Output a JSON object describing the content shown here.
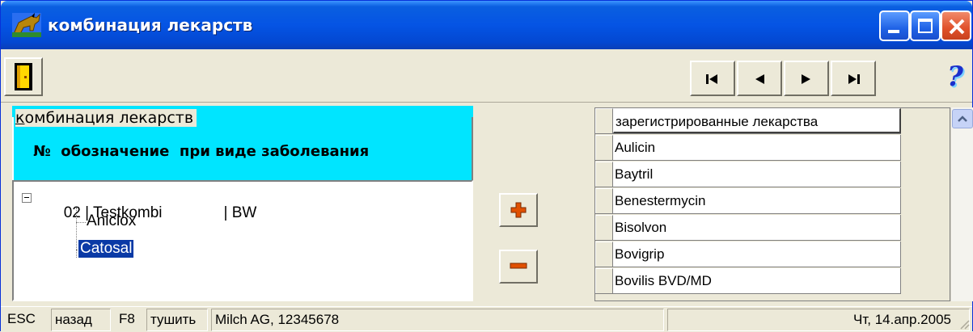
{
  "window": {
    "title": "комбинация лекарств",
    "title_icon": "horse-app-icon"
  },
  "toolbar": {
    "exit_icon": "door-exit-icon",
    "nav": [
      "first-record-icon",
      "previous-record-icon",
      "next-record-icon",
      "last-record-icon"
    ],
    "help_label": "?"
  },
  "left_panel": {
    "group_label_first": "к",
    "group_label_rest": "омбинация лекарств",
    "header": {
      "no": "№",
      "designation": "обозначение",
      "disease": "при виде заболевания"
    },
    "tree": {
      "root_no": "02",
      "root_name": "Testkombi",
      "root_species": "BW",
      "children": [
        "Aniclox",
        "Catosal"
      ],
      "selected": "Catosal"
    }
  },
  "buttons": {
    "add_icon": "plus-icon",
    "remove_icon": "minus-icon"
  },
  "grid": {
    "header": "зарегистрированные лекарства",
    "rows": [
      "Aulicin",
      "Baytril",
      "Benestermycin",
      "Bisolvon",
      "Bovigrip",
      "Bovilis BVD/MD"
    ]
  },
  "statusbar": {
    "esc_key": "ESC",
    "esc_label": "назад",
    "f8_key": "F8",
    "f8_label": "тушить",
    "company": "Milch AG, 12345678",
    "date": "Чт, 14.апр.2005"
  },
  "colors": {
    "title_bar": "#0554e4",
    "panel_cyan": "#00e5ff",
    "selection": "#0a3aa6"
  }
}
